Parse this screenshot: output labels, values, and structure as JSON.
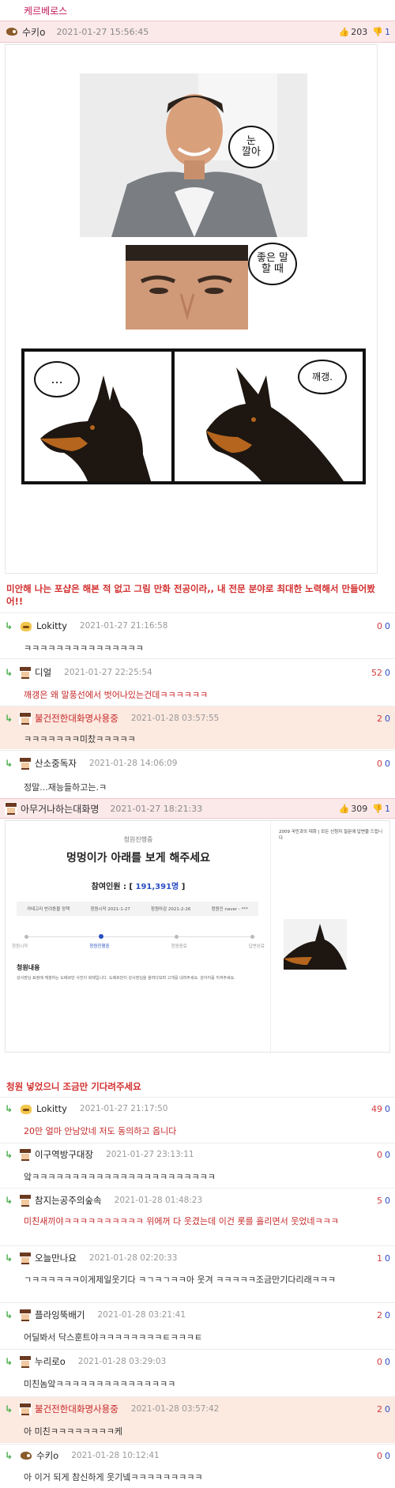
{
  "board": {
    "title": "케르베로스"
  },
  "post1": {
    "author": "수키o",
    "date": "2021-01-27 15:56:45",
    "upvotes": "203",
    "downvotes": "1",
    "bubble1": "눈\n깔아",
    "bubble2": "좋은 말\n할 때",
    "bubble3": "...",
    "bubble4": "깨갱.",
    "caption": "미안해 나는 포샵은 해본 적 없고 그림 만화 전공이라,, 내 전문 분야로 최대한 노력해서 만들어봤어!!"
  },
  "comments1": [
    {
      "author": "Lokitty",
      "date": "2021-01-27 21:16:58",
      "up": "0",
      "down": "0",
      "text": "ㅋㅋㅋㅋㅋㅋㅋㅋㅋㅋㅋㅋㅋㅋㅋ",
      "reply": true,
      "avatar": "cat",
      "highlight": false,
      "red": false
    },
    {
      "author": "디얼",
      "date": "2021-01-27 22:25:54",
      "up": "52",
      "down": "0",
      "text": "깨갱은 왜 말풍선에서 벗어나있는건데ㅋㅋㅋㅋㅋㅋ",
      "reply": true,
      "avatar": "pix",
      "highlight": false,
      "red": true
    },
    {
      "author": "불건전한대화명사용중",
      "date": "2021-01-28 03:57:55",
      "up": "2",
      "down": "0",
      "text": "ㅋㅋㅋㅋㅋㅋㅋ미찼ㅋㅋㅋㅋㅋ",
      "reply": true,
      "avatar": "pix",
      "highlight": true,
      "red": false
    },
    {
      "author": "산소중독자",
      "date": "2021-01-28 14:06:09",
      "up": "0",
      "down": "0",
      "text": "정말...재능들하고는.ㅋ",
      "reply": true,
      "avatar": "pix",
      "highlight": false,
      "red": false
    }
  ],
  "post2": {
    "author": "아무거나하는대화명",
    "date": "2021-01-27 18:21:33",
    "upvotes": "309",
    "downvotes": "1",
    "caption": "청원 넣었으니 조금만 기다려주세요",
    "petition": {
      "status_tag": "청원진행중",
      "title": "멍멍이가 아래를 보게 해주세요",
      "participants_label": "참여인원 : [",
      "participants": "191,391명",
      "participants_close": "]",
      "info_category": "카테고리  반려동물 정책",
      "info_start": "청원시작  2021-1-27",
      "info_end": "청원마감  2021-2-26",
      "info_author": "청원인  naver - ***",
      "steps": [
        "청원시작",
        "청원진행중",
        "청원종료",
        "답변완료"
      ],
      "content_title": "청원내용",
      "content_text": "강사장님 표정에 깨갱하는 도베르만 사진이 화제입니다. 도베르만이 강사장님을 올려다보며 고개를 내려주세요. 강아지를 지켜주세요.",
      "side_title": "2009 국민과의 대화 | 모든 신청자 질문에 답변을 드립니다"
    }
  },
  "comments2": [
    {
      "author": "Lokitty",
      "date": "2021-01-27 21:17:50",
      "up": "49",
      "down": "0",
      "text": "20만 얼마 안남았네 저도 동의하고 옵니다",
      "reply": true,
      "avatar": "cat",
      "highlight": false,
      "red": true
    },
    {
      "author": "이구역방구대장",
      "date": "2021-01-27 23:13:11",
      "up": "0",
      "down": "0",
      "text": "앜ㅋㅋㅋㅋㅋㅋㅋㅋㅋㅋㅋㅋㅋㅋㅋㅋㅋㅋㅋㅋㅋㅋㅋ",
      "reply": true,
      "avatar": "pix",
      "highlight": false,
      "red": false
    },
    {
      "author": "참지는공주의숲속",
      "date": "2021-01-28 01:48:23",
      "up": "5",
      "down": "0",
      "text": "미친새끼야ㅋㅋㅋㅋㅋㅋㅋㅋㅋㅋ 위에꺼 다 웃겼는데 이건 롯를 흘리면서 웃었네ㅋㅋㅋ",
      "reply": true,
      "avatar": "pix",
      "highlight": false,
      "red": true
    },
    {
      "author": "오늘만나요",
      "date": "2021-01-28 02:20:33",
      "up": "1",
      "down": "0",
      "text": "ㄱㅋㅋㅋㅋㅋㅋ이게제일웃기다 ㅋㄱㅋㄱㅋㅋ아 웃겨 ㅋㅋㅋㅋㅋ조금만기다리래ㅋㅋㅋ",
      "reply": true,
      "avatar": "pix",
      "highlight": false,
      "red": false
    },
    {
      "author": "플라잉뚝배기",
      "date": "2021-01-28 03:21:41",
      "up": "2",
      "down": "0",
      "text": "어딜봐서 닥스훈트야ㅋㅋㅋㅋㅋㅋㅋㅋㅌㅋㅋㅋㅌ",
      "reply": true,
      "avatar": "pix",
      "highlight": false,
      "red": false
    },
    {
      "author": "누리로o",
      "date": "2021-01-28 03:29:03",
      "up": "0",
      "down": "0",
      "text": "미친놈앜ㅋㅋㅋㅋㅋㅋㅋㅋㅋㅋㅋㅋㅋㅋㅋ",
      "reply": true,
      "avatar": "pix",
      "highlight": false,
      "red": false
    },
    {
      "author": "불건전한대화명사용중",
      "date": "2021-01-28 03:57:42",
      "up": "2",
      "down": "0",
      "text": "아 미친ㅋㅋㅋㅋㅋㅋㅋㅋ케",
      "reply": true,
      "avatar": "pix",
      "highlight": true,
      "red": false
    },
    {
      "author": "수키o",
      "date": "2021-01-28 10:12:41",
      "up": "0",
      "down": "0",
      "text": "아 이거 되게 참신하게 웃기넼ㅋㅋㅋㅋㅋㅋㅋㅋㅋ",
      "reply": true,
      "avatar": "fox",
      "highlight": false,
      "red": false
    }
  ]
}
